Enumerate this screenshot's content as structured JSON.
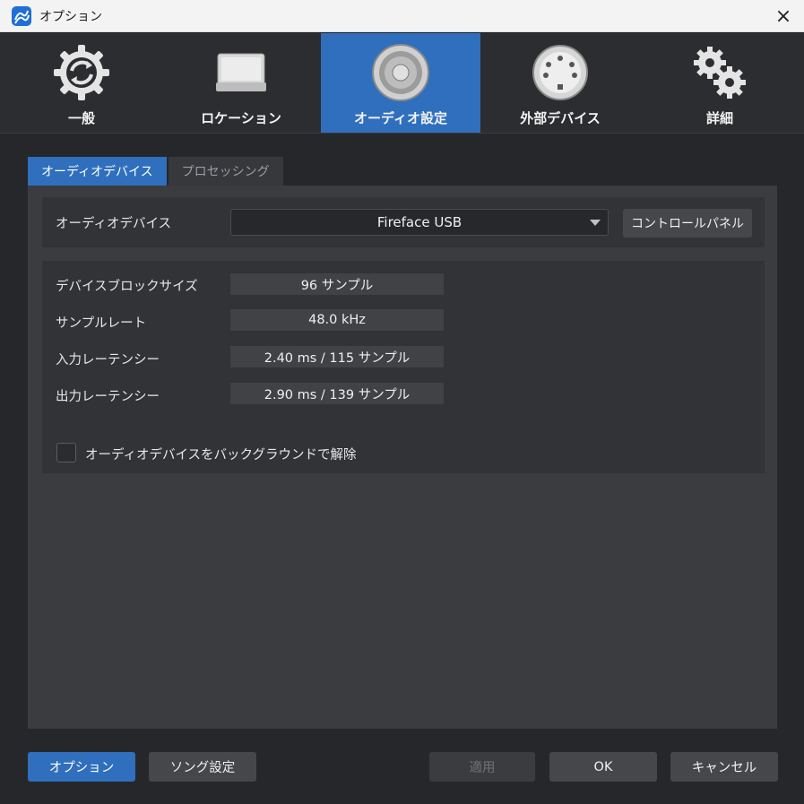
{
  "window": {
    "title": "オプション",
    "app_icon": "studio-one-logo-icon",
    "close_icon": "×"
  },
  "categories": [
    {
      "label": "一般",
      "icon": "refresh-gear-icon",
      "active": false
    },
    {
      "label": "ロケーション",
      "icon": "drive-icon",
      "active": false
    },
    {
      "label": "オーディオ設定",
      "icon": "speaker-icon",
      "active": true
    },
    {
      "label": "外部デバイス",
      "icon": "midi-port-icon",
      "active": false
    },
    {
      "label": "詳細",
      "icon": "gears-icon",
      "active": false
    }
  ],
  "tabs": [
    {
      "label": "オーディオデバイス",
      "active": true
    },
    {
      "label": "プロセッシング",
      "active": false
    }
  ],
  "device": {
    "label": "オーディオデバイス",
    "selected": "Fireface USB",
    "control_panel_label": "コントロールパネル"
  },
  "info": {
    "block_size_label": "デバイスブロックサイズ",
    "block_size_value": "96 サンプル",
    "sample_rate_label": "サンプルレート",
    "sample_rate_value": "48.0 kHz",
    "input_latency_label": "入力レーテンシー",
    "input_latency_value": "2.40 ms / 115 サンプル",
    "output_latency_label": "出力レーテンシー",
    "output_latency_value": "2.90 ms / 139 サンプル",
    "background_release_label": "オーディオデバイスをバックグラウンドで解除",
    "background_release_checked": false
  },
  "footer": {
    "options_label": "オプション",
    "song_settings_label": "ソング設定",
    "apply_label": "適用",
    "ok_label": "OK",
    "cancel_label": "キャンセル"
  },
  "colors": {
    "accent": "#2f6fbd",
    "background": "#26272a",
    "panel": "#3a3c40"
  }
}
